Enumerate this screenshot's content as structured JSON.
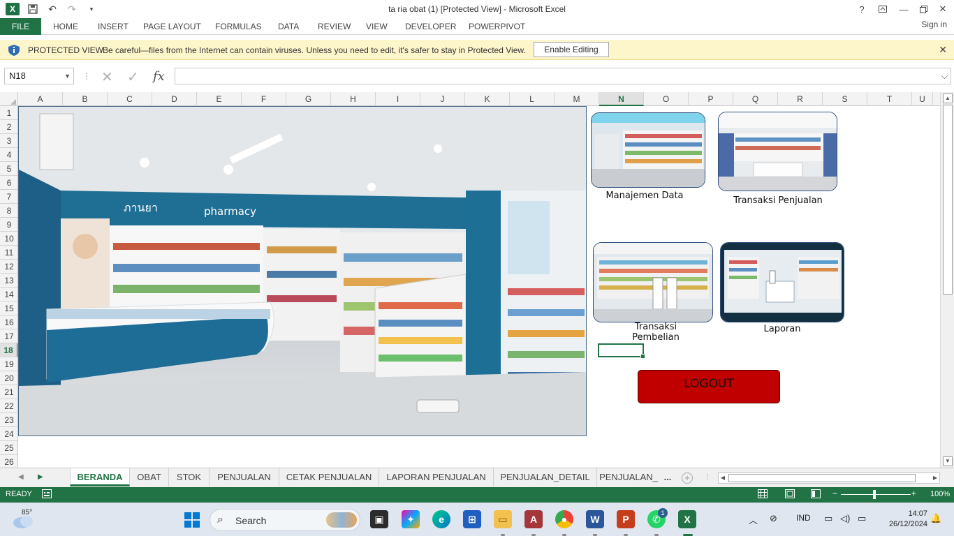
{
  "window": {
    "title": "ta ria obat (1)  [Protected View] - Microsoft Excel",
    "help": "?",
    "sign_in": "Sign in"
  },
  "ribbon": {
    "file": "FILE",
    "tabs": [
      "HOME",
      "INSERT",
      "PAGE LAYOUT",
      "FORMULAS",
      "DATA",
      "REVIEW",
      "VIEW",
      "DEVELOPER",
      "POWERPIVOT"
    ]
  },
  "protected_view": {
    "title": "PROTECTED VIEW",
    "message": "Be careful—files from the Internet can contain viruses. Unless you need to edit, it's safer to stay in Protected View.",
    "button": "Enable Editing"
  },
  "formula_bar": {
    "name_box": "N18",
    "formula": ""
  },
  "columns": [
    "A",
    "B",
    "C",
    "D",
    "E",
    "F",
    "G",
    "H",
    "I",
    "J",
    "K",
    "L",
    "M",
    "N",
    "O",
    "P",
    "Q",
    "R",
    "S",
    "T",
    "U"
  ],
  "active_column": "N",
  "rows": [
    "1",
    "2",
    "3",
    "4",
    "5",
    "6",
    "7",
    "8",
    "9",
    "10",
    "11",
    "12",
    "13",
    "14",
    "15",
    "16",
    "17",
    "18",
    "19",
    "20",
    "21",
    "22",
    "23",
    "24",
    "25",
    "26"
  ],
  "active_row": "18",
  "dashboard": {
    "buttons": [
      {
        "label": "Manajemen Data"
      },
      {
        "label": "Transaksi Penjualan"
      },
      {
        "label": "Transaksi Pembelian"
      },
      {
        "label": "Laporan"
      }
    ],
    "logout": "LOGOUT"
  },
  "sheet_tabs": {
    "tabs": [
      "BERANDA",
      "OBAT",
      "STOK",
      "PENJUALAN",
      "CETAK PENJUALAN",
      "LAPORAN PENJUALAN",
      "PENJUALAN_DETAIL",
      "PENJUALAN_"
    ],
    "active": "BERANDA",
    "more": "..."
  },
  "status_bar": {
    "status": "READY",
    "zoom": "100%",
    "zoom_fraction": 0.5
  },
  "taskbar": {
    "temperature": "85°",
    "search": "Search",
    "tray_lang": "IND",
    "time": "14:07",
    "date": "26/12/2024",
    "whatsapp_badge": "1"
  },
  "colors": {
    "excel_green": "#217346",
    "logout_red": "#c00000",
    "protected_bar": "#fef6cb"
  }
}
